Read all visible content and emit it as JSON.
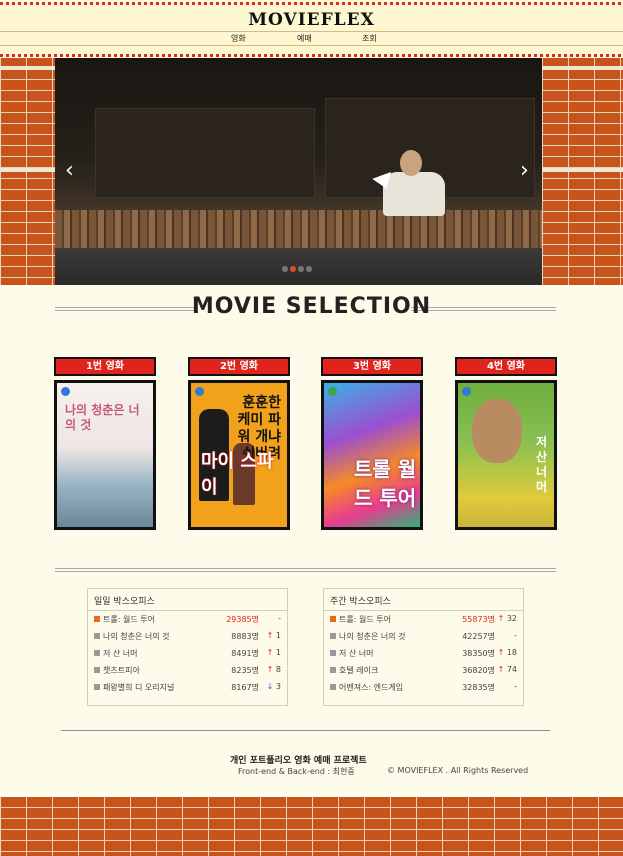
{
  "header": {
    "logo": "MOVIEFLEX",
    "nav": [
      "영화",
      "예매",
      "조회"
    ]
  },
  "slider": {
    "prev_icon": "‹",
    "next_icon": "›",
    "dots": 4,
    "active_dot": 1
  },
  "section_title": "MOVIE SELECTION",
  "movies": [
    {
      "label": "1번 영화",
      "title": "나의 청춘은 너의 것"
    },
    {
      "label": "2번 영화",
      "title": "훈훈한 케미 파워 개냐 쉬버려",
      "title_big": "마이 스파이"
    },
    {
      "label": "3번 영화",
      "title": "트롤 월드 투어"
    },
    {
      "label": "4번 영화",
      "title": "저 산 너머"
    }
  ],
  "daily": {
    "title": "일일 박스오피스",
    "rows": [
      {
        "title": "트롤: 월드 투어",
        "audience": "29385명",
        "change": "-",
        "dir": "none"
      },
      {
        "title": "나의 청춘은 너의 것",
        "audience": "8883명",
        "change": "1",
        "dir": "up"
      },
      {
        "title": "저 산 너머",
        "audience": "8491명",
        "change": "1",
        "dir": "up"
      },
      {
        "title": "챗츠트피아",
        "audience": "8235명",
        "change": "8",
        "dir": "up"
      },
      {
        "title": "패왕별희 디 오리지널",
        "audience": "8167명",
        "change": "3",
        "dir": "down"
      }
    ]
  },
  "weekly": {
    "title": "주간 박스오피스",
    "rows": [
      {
        "title": "트롤: 월드 투어",
        "audience": "55873명",
        "change": "32",
        "dir": "up"
      },
      {
        "title": "나의 청춘은 너의 것",
        "audience": "42257명",
        "change": "-",
        "dir": "none"
      },
      {
        "title": "저 산 너머",
        "audience": "38350명",
        "change": "18",
        "dir": "up"
      },
      {
        "title": "호텔 레이크",
        "audience": "36820명",
        "change": "74",
        "dir": "up"
      },
      {
        "title": "어벤져스: 엔드게임",
        "audience": "32835명",
        "change": "-",
        "dir": "none"
      }
    ]
  },
  "footer": {
    "line1": "개인 포트폴리오 영화 예매 프로젝트",
    "line2": "Front-end & Back-end : 최현중",
    "line3": "© MOVIEFLEX . All Rights Reserved"
  },
  "colors": {
    "brick": "#c8541b",
    "label_red": "#e0231d",
    "background": "#fdfbe9"
  }
}
